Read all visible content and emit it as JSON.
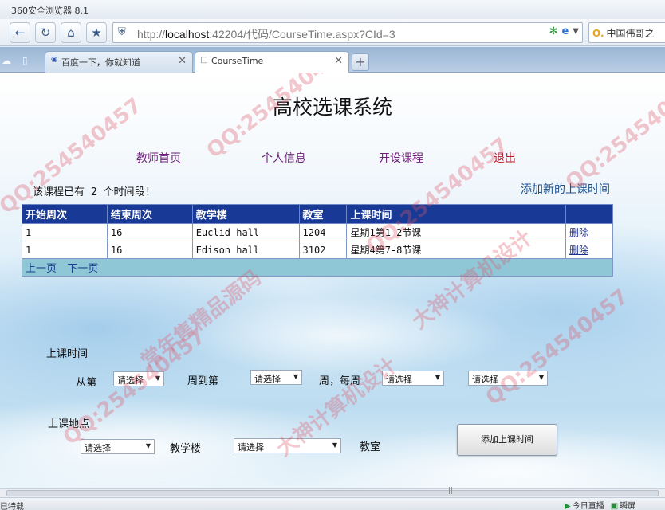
{
  "browser": {
    "title": "360安全浏览器 8.1",
    "url_prefix": "http://",
    "url_host": "localhost",
    "url_path": ":42204/代码/CourseTime.aspx?CId=3",
    "search_text": "中国伟哥之",
    "nav_icons": [
      "back-icon",
      "refresh-icon",
      "home-icon",
      "star-icon"
    ],
    "tabs": [
      {
        "label": "百度一下，你就知道",
        "active": false
      },
      {
        "label": "CourseTime",
        "active": true
      }
    ]
  },
  "page": {
    "title": "高校选课系统",
    "nav": {
      "teacher_home": "教师首页",
      "personal_info": "个人信息",
      "open_course": "开设课程",
      "logout": "退出"
    },
    "count_text": "该课程已有 2 个时间段!",
    "add_time_link": "添加新的上课时间",
    "table": {
      "headers": [
        "开始周次",
        "结束周次",
        "教学楼",
        "教室",
        "上课时间",
        ""
      ],
      "rows": [
        [
          "1",
          "16",
          "Euclid hall",
          "1204",
          "星期1第1-2节课",
          "删除"
        ],
        [
          "1",
          "16",
          "Edison hall",
          "3102",
          "星期4第7-8节课",
          "删除"
        ]
      ],
      "pager": {
        "prev": "上一页",
        "next": "下一页"
      }
    },
    "form": {
      "time_label": "上课时间",
      "from_week": "从第",
      "to_week": "周到第",
      "every_week": "周，每周",
      "location_label": "上课地点",
      "building": "教学楼",
      "classroom": "教室",
      "placeholder": "请选择",
      "submit": "添加上课时间"
    }
  },
  "status": {
    "left": "已特载",
    "live": "今日直播",
    "screenshot": "瞬屏"
  },
  "watermark": {
    "qq": "QQ:254540457",
    "a": "大神计算机设计",
    "b": "常年售精品源码"
  }
}
